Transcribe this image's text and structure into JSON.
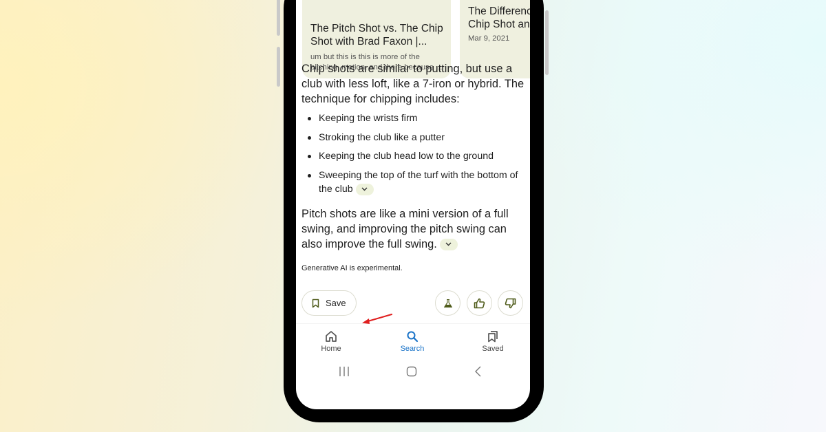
{
  "cards": [
    {
      "title": "The Pitch Shot vs. The Chip Shot with Brad Faxon |...",
      "title_line1": "The Pitch Shot vs. The Chip",
      "title_line2": "Shot with Brad Faxon |...",
      "snippet_line1": "um but this is this is more of the",
      "snippet_line2": "pitching. motion. and there because ..."
    },
    {
      "title_line1": "The Differenc",
      "title_line2": "Chip Shot an",
      "date": "Mar 9, 2021"
    }
  ],
  "answer": {
    "intro": "Chip shots are similar to putting, but use a club with less loft, like a 7-iron or hybrid. The technique for chipping includes:",
    "bullets": [
      "Keeping the wrists firm",
      "Stroking the club like a putter",
      "Keeping the club head low to the ground",
      "Sweeping the top of the turf with the bottom of the club"
    ],
    "pitch": "Pitch shots are like a mini version of a full swing, and improving the pitch swing can also improve the full swing.",
    "disclaimer": "Generative AI is experimental."
  },
  "actions": {
    "save_label": "Save",
    "icons": [
      "flask-icon",
      "thumbs-up-icon",
      "thumbs-down-icon"
    ]
  },
  "bottom_nav": {
    "items": [
      {
        "label": "Home",
        "icon": "home-icon",
        "active": false
      },
      {
        "label": "Search",
        "icon": "search-icon",
        "active": true
      },
      {
        "label": "Saved",
        "icon": "saved-icon",
        "active": false
      }
    ]
  },
  "colors": {
    "accent_active": "#1a73c8",
    "icon_green": "#4f5b1a",
    "card_bg": "#eff0df",
    "annotation_arrow": "#e02020"
  }
}
